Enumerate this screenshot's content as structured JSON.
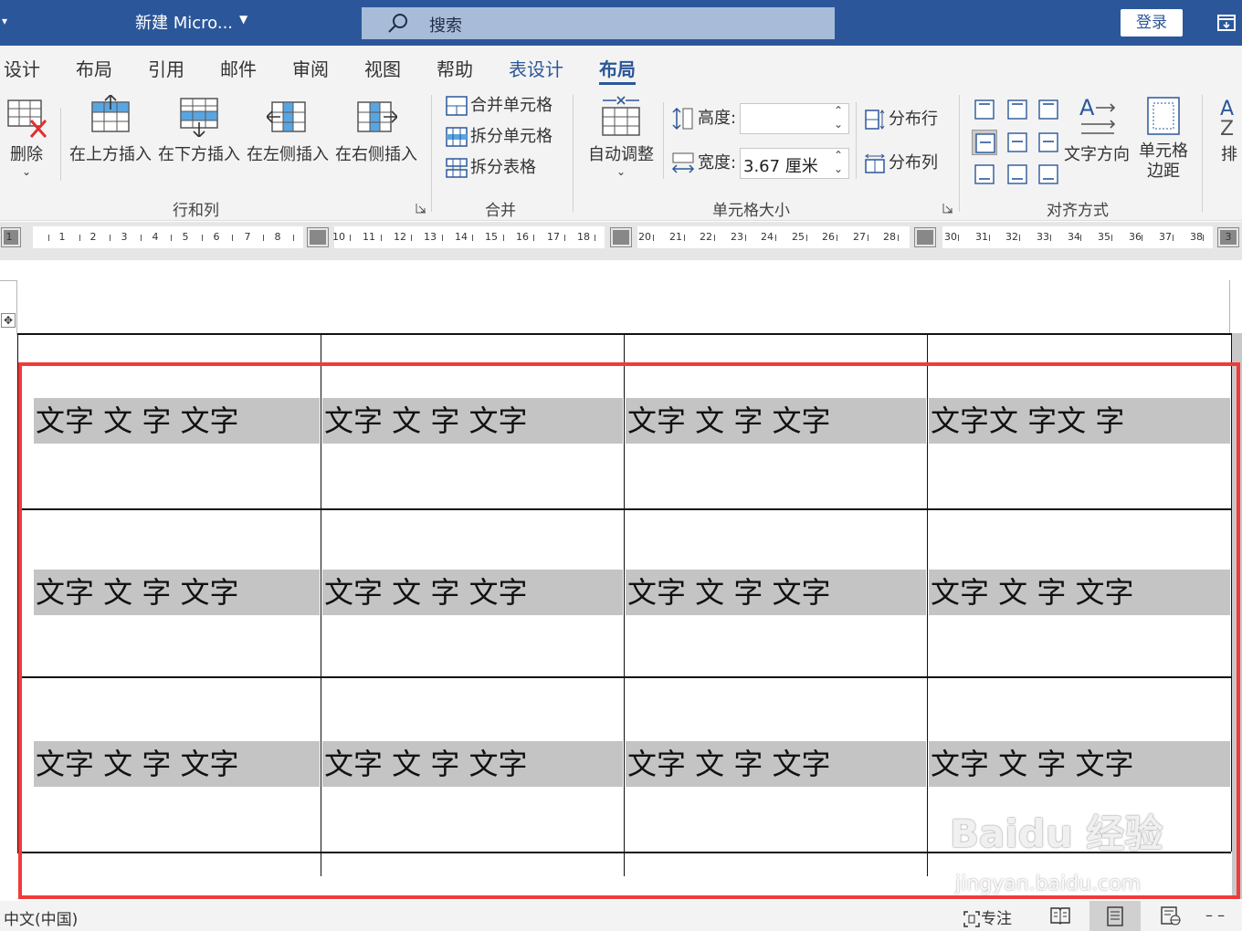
{
  "titlebar": {
    "doc_title": "新建 Micro...",
    "search_placeholder": "搜索",
    "login_label": "登录"
  },
  "tabs": [
    {
      "label": "设计"
    },
    {
      "label": "布局"
    },
    {
      "label": "引用"
    },
    {
      "label": "邮件"
    },
    {
      "label": "审阅"
    },
    {
      "label": "视图"
    },
    {
      "label": "帮助"
    },
    {
      "label": "表设计"
    },
    {
      "label": "布局"
    }
  ],
  "ribbon": {
    "rows_cols": {
      "delete": "删除",
      "insert_above": "在上方插入",
      "insert_below": "在下方插入",
      "insert_left": "在左侧插入",
      "insert_right": "在右侧插入",
      "group_label": "行和列"
    },
    "merge": {
      "merge_cells": "合并单元格",
      "split_cells": "拆分单元格",
      "split_table": "拆分表格",
      "group_label": "合并"
    },
    "cell_size": {
      "autofit": "自动调整",
      "height_label": "高度:",
      "height_value": "",
      "width_label": "宽度:",
      "width_value": "3.67 厘米",
      "distribute_rows": "分布行",
      "distribute_cols": "分布列",
      "group_label": "单元格大小"
    },
    "alignment": {
      "text_direction": "文字方向",
      "cell_margins_line1": "单元格",
      "cell_margins_line2": "边距",
      "sort": "排",
      "group_label": "对齐方式"
    }
  },
  "ruler": {
    "numbers": [
      "1",
      "1",
      "2",
      "3",
      "4",
      "5",
      "6",
      "7",
      "8",
      "10",
      "11",
      "12",
      "13",
      "14",
      "15",
      "16",
      "17",
      "18",
      "20",
      "21",
      "22",
      "23",
      "24",
      "25",
      "26",
      "27",
      "28",
      "30",
      "31",
      "32",
      "33",
      "34",
      "35",
      "36",
      "37",
      "38",
      "3"
    ]
  },
  "table": {
    "rows": [
      [
        "文字 文 字 文字",
        "文字 文 字 文字",
        "文字 文 字 文字",
        "文字文 字文 字"
      ],
      [
        "文字 文 字 文字",
        "文字 文 字 文字",
        "文字 文 字 文字",
        "文字 文 字 文字"
      ],
      [
        "文字 文 字 文字",
        "文字 文 字 文字",
        "文字 文 字 文字",
        "文字 文 字 文字"
      ]
    ]
  },
  "statusbar": {
    "language": "中文(中国)",
    "focus": "专注"
  },
  "watermark": {
    "brand": "Baidu 经验",
    "url": "jingyan.baidu.com"
  },
  "colors": {
    "title_bar": "#2b579a",
    "ribbon_bg": "#f3f3f3",
    "highlight_border": "#f23a3a",
    "text_shading": "#c4c4c4"
  }
}
